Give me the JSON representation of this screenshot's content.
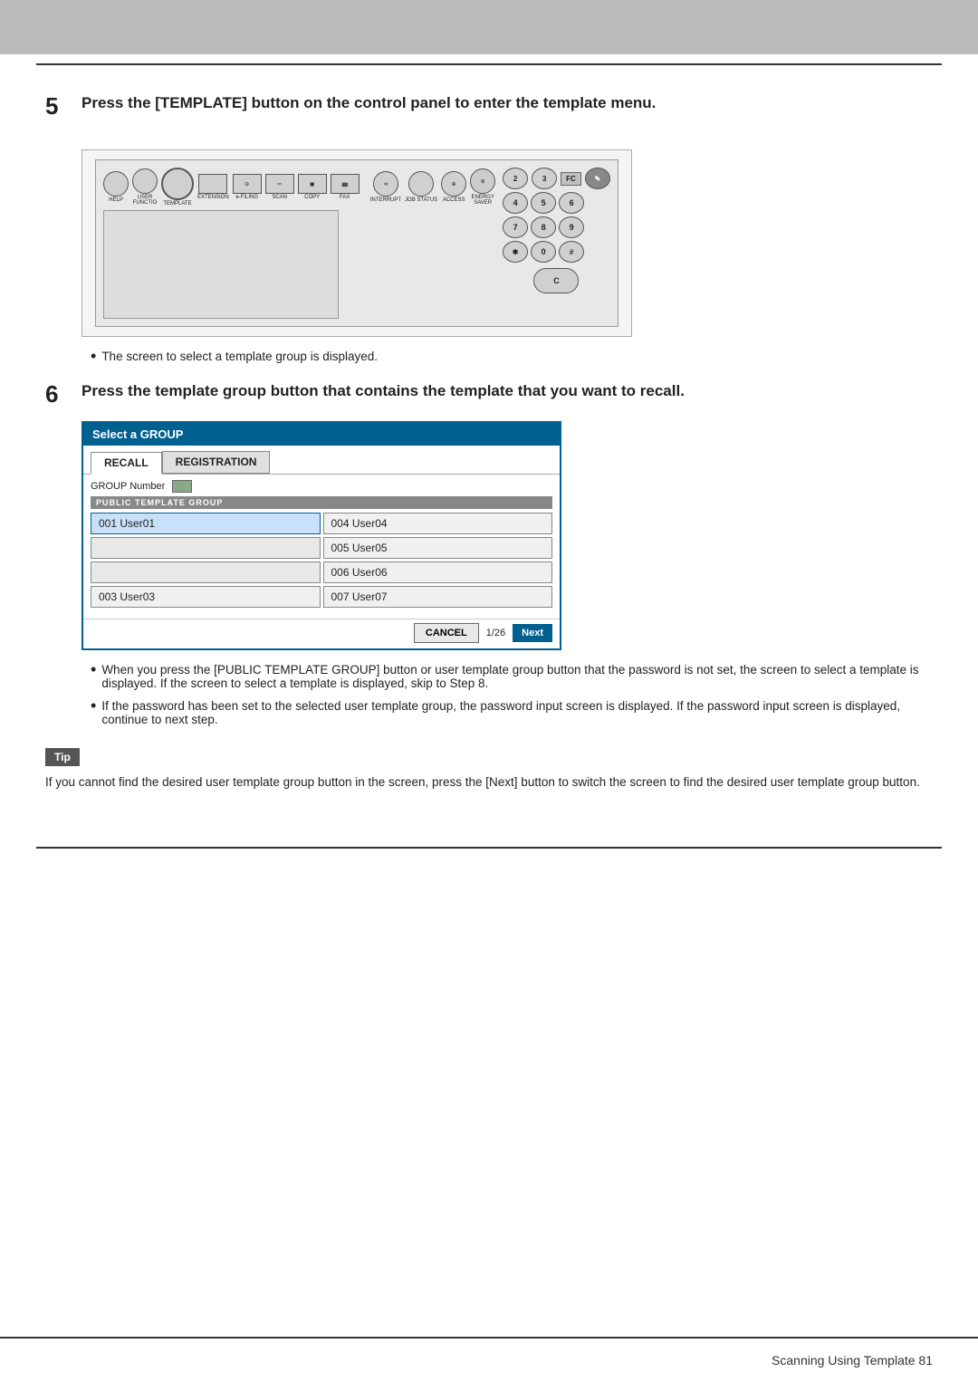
{
  "topBar": {},
  "step5": {
    "number": "5",
    "title": "Press the [TEMPLATE] button on the control panel to enter the template menu.",
    "bullet": "The screen to select a template group is displayed."
  },
  "step6": {
    "number": "6",
    "title": "Press the template group button that contains the template that you want to recall."
  },
  "screenUI": {
    "header": "Select a GROUP",
    "tabRecall": "RECALL",
    "tabRegistration": "REGISTRATION",
    "groupNumberLabel": "GROUP Number",
    "publicTemplateBar": "PUBLIC TEMPLATE GROUP",
    "users": [
      {
        "id": "001",
        "name": "User01"
      },
      {
        "id": "004",
        "name": "User04"
      },
      {
        "id": "",
        "name": ""
      },
      {
        "id": "005",
        "name": "User05"
      },
      {
        "id": "",
        "name": ""
      },
      {
        "id": "006",
        "name": "User06"
      },
      {
        "id": "003",
        "name": "User03"
      },
      {
        "id": "007",
        "name": "User07"
      }
    ],
    "cancelLabel": "CANCEL",
    "pageIndicator": "1/26",
    "nextLabel": "Next"
  },
  "bullets": {
    "b1": "When you press the [PUBLIC TEMPLATE GROUP] button or user template group button that the password is not set, the screen to select a template is displayed.  If the screen to select a template is displayed, skip to Step 8.",
    "b2": "If the password has been set to the selected user template group, the password input screen is displayed.  If the password input screen is displayed, continue to next step."
  },
  "tip": {
    "label": "Tip",
    "text": "If you cannot find the desired user template group button in the screen, press the [Next] button to switch the screen to find the desired user template group button."
  },
  "footer": {
    "text": "Scanning Using Template   81"
  }
}
